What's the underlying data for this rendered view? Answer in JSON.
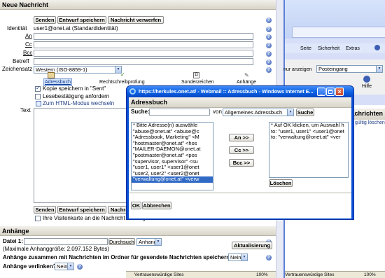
{
  "compose": {
    "title": "Neue Nachricht",
    "buttons": {
      "send": "Senden",
      "save_draft": "Entwurf speichern",
      "discard": "Nachricht verwerfen"
    },
    "fields": {
      "identity_label": "Identität",
      "identity_value": "user1@onet.at (Standardidentität)",
      "to_label": "An",
      "cc_label": "Cc",
      "bcc_label": "Bcc",
      "subject_label": "Betreff",
      "charset_label": "Zeichensatz",
      "charset_value": "Western (ISO-8859-1)",
      "text_label": "Text"
    },
    "tools": {
      "addressbook": "Adressbuch",
      "spellcheck": "Rechtschreibprüfung",
      "special_chars": "Sonderzeichen",
      "attachments": "Anhänge"
    },
    "options": {
      "save_copy": "Kopie speichern in \"Sent\"",
      "read_receipt": "Lesebestätigung anfordern",
      "html_mode": "Zum HTML-Modus wechseln",
      "vcard": "Ihre Visitenkarte an die Nachricht anhängen"
    }
  },
  "attachments": {
    "title": "Anhänge",
    "file_label": "Datei 1:",
    "browse": "Durchsuchen...",
    "type_value": "Anhang",
    "max_size": "(Maximale Anhanggröße: 2.097.152 Bytes)",
    "update": "Aktualisierung",
    "save_question": "Anhänge zusammen mit Nachrichten im Ordner für gesendete Nachrichten speichern?",
    "save_value": "Nein",
    "link_question": "Anhänge verlinken?",
    "link_value": "Nein"
  },
  "background_ie": {
    "menu": [
      "Seite",
      "Sicherheit",
      "Extras"
    ],
    "show_label": "nur anzeigen",
    "folder_value": "Posteingang",
    "help_label": "Hilfe",
    "messages_heading": "Nachrichten",
    "delete_link": "gültig löschen",
    "status_sites": "Vertrauenswürdige Sites",
    "zoom_left": "100%",
    "status_right": "Vertrauenswürdige Sites",
    "zoom_right": "100%"
  },
  "popup": {
    "window_title": "https://herkules.onet.at/ - Webmail :: Adressbuch - Windows Internet E...",
    "heading": "Adressbuch",
    "search_label": "Suche:",
    "search_value": "",
    "from_label": "von",
    "source_value": "Allgemeines Adressbuch",
    "search_button": "Suche",
    "results": [
      "* Bitte Adresse(n) auswähle",
      "\"abuse@onet.at\" <abuse@c",
      "\"Adressbook, Marketing\" <M",
      "\"hostmaster@onet.at\" <hos",
      "\"MAILER-DAEMON@onet.at",
      "\"postmaster@onet.at\" <pos",
      "\"supervisor, supervisor\" <su",
      "\"user1, user1\" <user1@onet",
      "\"user2, user2\" <user2@onet",
      "\"verwaltung@onet.at\" <verw"
    ],
    "selected_index": 9,
    "to_button": "An >>",
    "cc_button": "Cc >>",
    "bcc_button": "Bcc >>",
    "recipients": [
      "* Auf OK klicken, um Auswahl h",
      "to: \"user1, user1\" <user1@onet",
      "to: \"verwaltung@onet.at\" <ver"
    ],
    "delete_button": "Löschen",
    "ok_button": "OK",
    "cancel_button": "Abbrechen"
  }
}
